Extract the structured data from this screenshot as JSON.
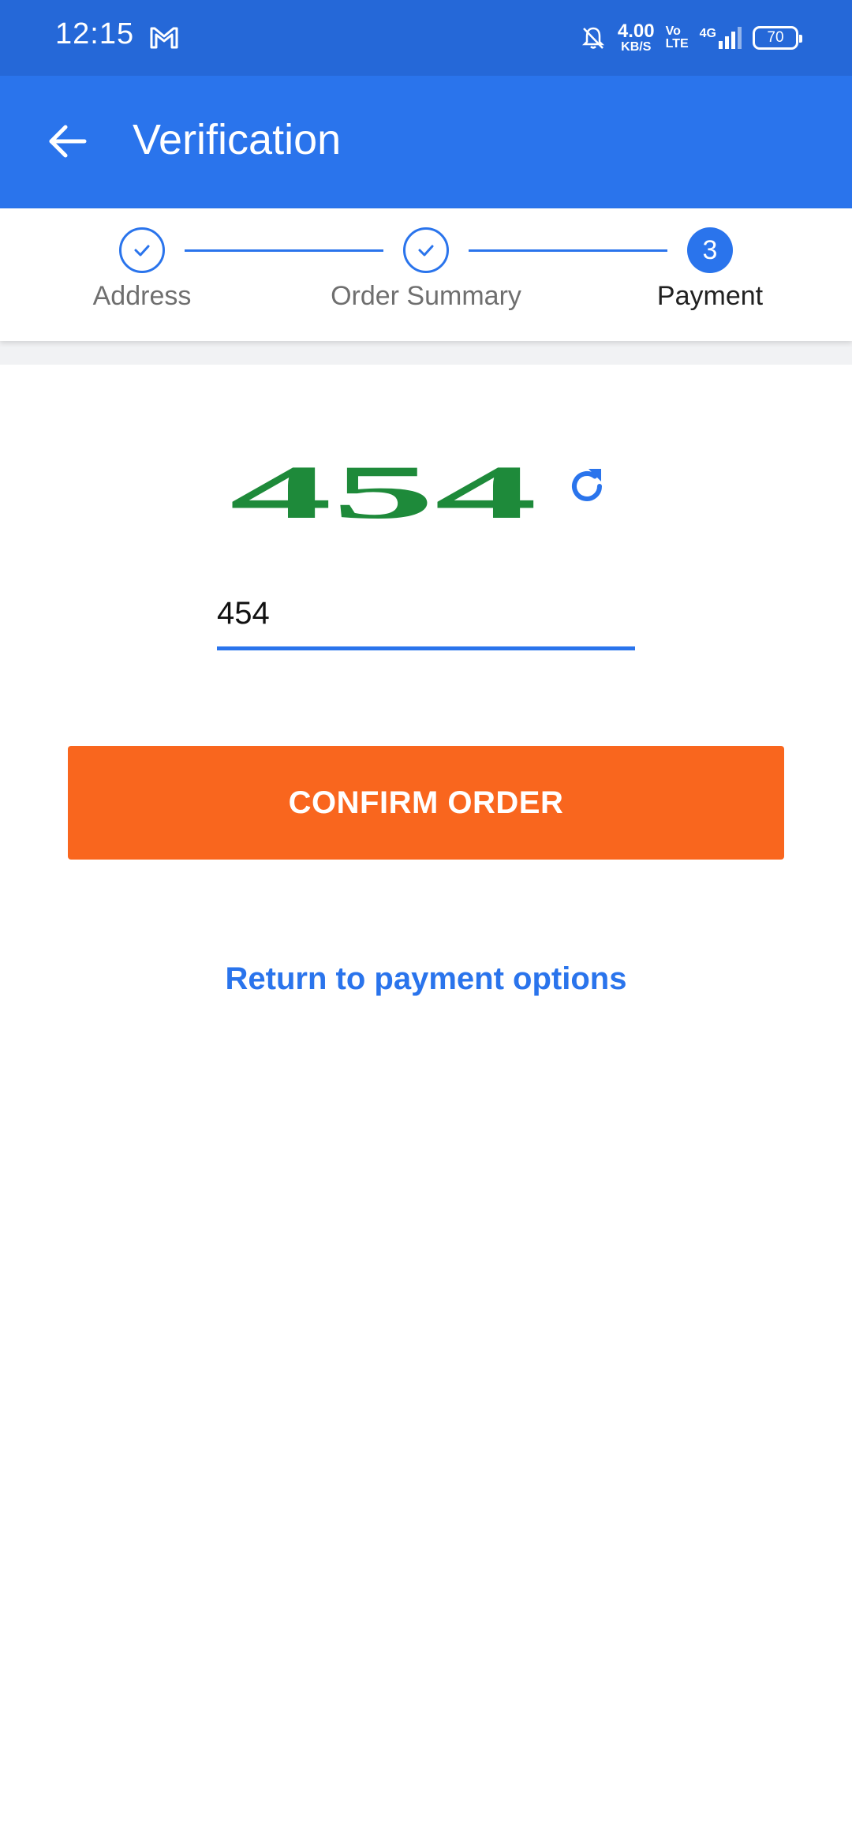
{
  "status_bar": {
    "time": "12:15",
    "net_speed_value": "4.00",
    "net_speed_unit": "KB/S",
    "volte_top": "Vo",
    "volte_bottom": "LTE",
    "network": "4G",
    "battery": "70",
    "icons": [
      "gmail-icon",
      "bell-off-icon",
      "signal-icon",
      "battery-icon"
    ]
  },
  "app_bar": {
    "title": "Verification",
    "back_icon": "arrow-left-icon"
  },
  "stepper": {
    "steps": [
      {
        "label": "Address",
        "state": "done"
      },
      {
        "label": "Order Summary",
        "state": "done"
      },
      {
        "label": "Payment",
        "state": "active",
        "number": "3"
      }
    ]
  },
  "captcha": {
    "image_text": "454",
    "image_color": "#1e8a3a",
    "refresh_icon": "refresh-icon",
    "input_value": "454"
  },
  "actions": {
    "confirm_label": "CONFIRM ORDER",
    "return_label": "Return to payment options"
  },
  "colors": {
    "status_bar": "#2568d8",
    "app_bar": "#2a74ec",
    "accent": "#2a74ec",
    "confirm": "#f9661e"
  }
}
